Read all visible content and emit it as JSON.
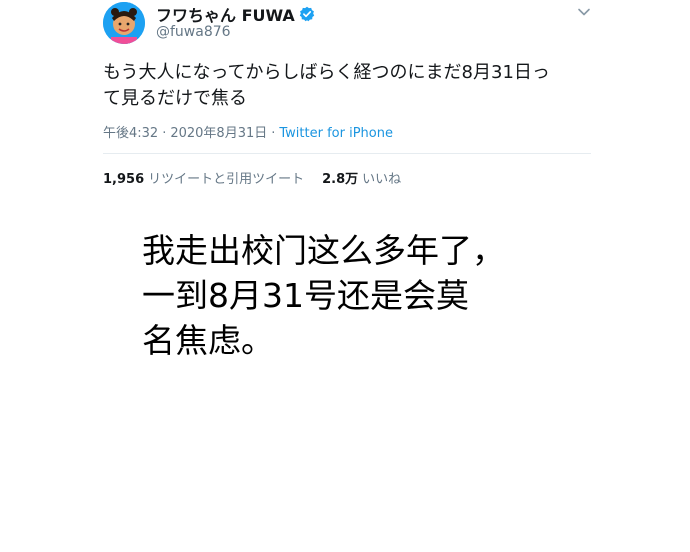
{
  "user": {
    "display_name": "フワちゃん FUWA",
    "handle": "@fuwa876"
  },
  "tweet": {
    "text_line1": "もう大人になってからしばらく経つのにまだ8月31日っ",
    "text_line2": "て見るだけで焦る",
    "time": "午後4:32",
    "separator": "·",
    "date": "2020年8月31日",
    "source": "Twitter for iPhone"
  },
  "stats": {
    "retweets_count": "1,956",
    "retweets_label": "リツイートと引用ツイート",
    "likes_count": "2.8万",
    "likes_label": "いいね"
  },
  "caption": {
    "line1": "我走出校门这么多年了，",
    "line2": "一到8月31号还是会莫",
    "line3": "名焦虑。"
  },
  "colors": {
    "accent": "#1da1f2",
    "secondary_text": "#657786"
  },
  "icons": [
    "avatar",
    "verified-badge-icon",
    "chevron-down-icon"
  ]
}
